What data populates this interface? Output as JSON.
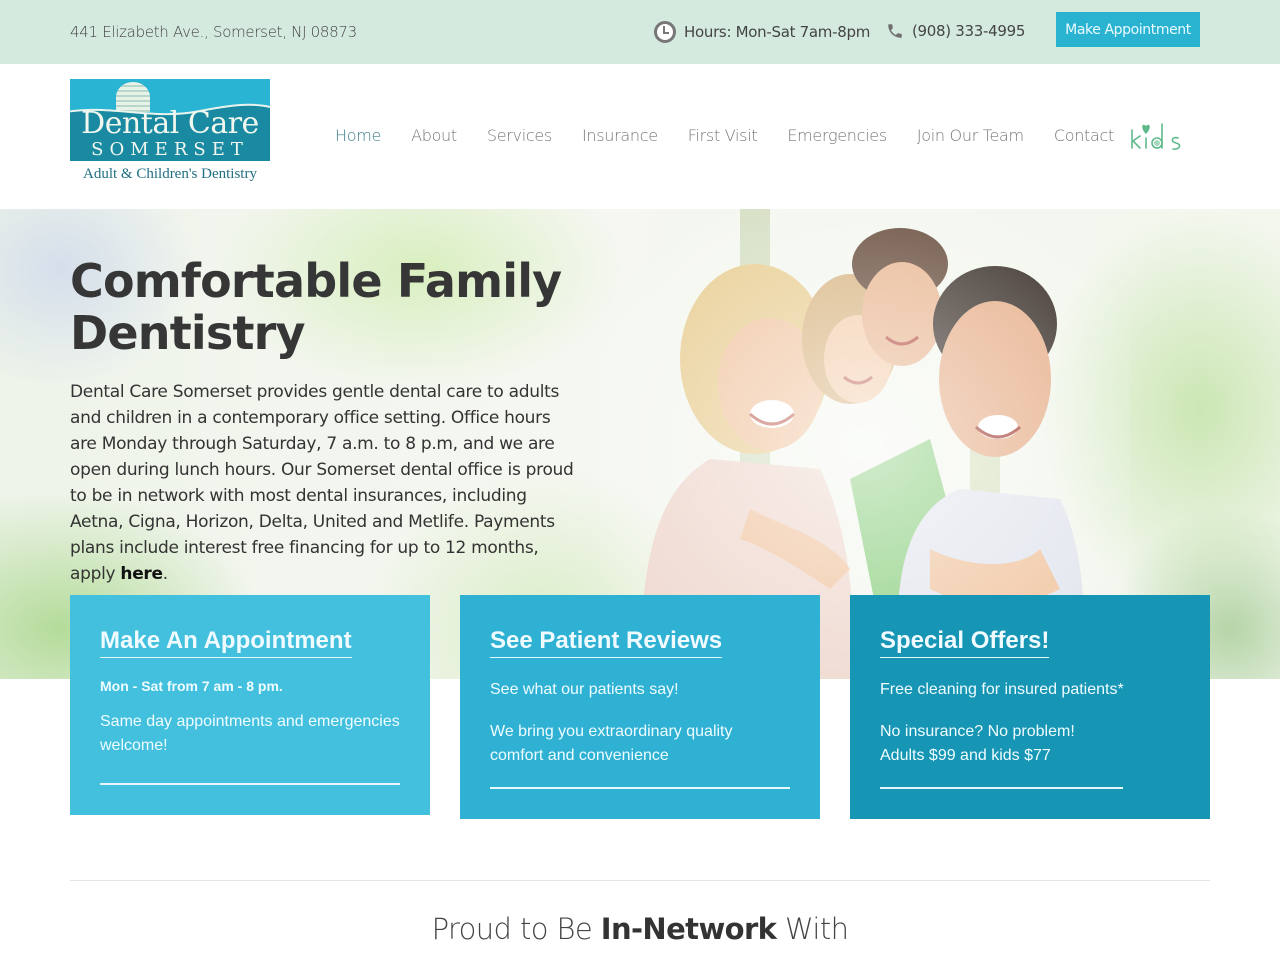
{
  "topbar": {
    "address": "441 Elizabeth Ave., Somerset, NJ 08873",
    "hours": "Hours: Mon-Sat 7am-8pm",
    "phone": "(908) 333-4995",
    "appointment_button": "Make Appointment",
    "hours_icon": "clock-icon",
    "phone_icon": "phone-icon"
  },
  "logo": {
    "name": "Dental Care",
    "city": "SOMERSET",
    "tagline": "Adult & Children's Dentistry"
  },
  "nav": {
    "items": [
      {
        "label": "Home",
        "active": true
      },
      {
        "label": "About"
      },
      {
        "label": "Services"
      },
      {
        "label": "Insurance"
      },
      {
        "label": "First Visit"
      },
      {
        "label": "Emergencies"
      },
      {
        "label": "Join Our Team"
      },
      {
        "label": "Contact"
      }
    ],
    "kids_label": "kids"
  },
  "hero": {
    "title_line1": "Comfortable Family",
    "title_line2": "Dentistry",
    "body": "Dental Care Somerset provides gentle dental care to adults and children in a contemporary office setting. Office hours are Monday through Saturday, 7 a.m. to 8 p.m, and we are open during lunch hours. Our Somerset dental office is proud to be in network with most dental insurances, including Aetna, Cigna, Horizon, Delta, United and Metlife. Payments plans include interest free financing for up to 12 months, apply ",
    "link_label": "here",
    "body_end": "."
  },
  "cards": [
    {
      "title": "Make An Appointment",
      "subtitle": "Mon - Sat from 7 am - 8 pm.",
      "lines": [
        "Same day appointments and emergencies welcome!"
      ],
      "color": "#44c0df"
    },
    {
      "title": "See Patient Reviews",
      "lines": [
        "See what our patients say!",
        "We bring you extraordinary quality comfort and convenience"
      ],
      "color": "#2fb1d4"
    },
    {
      "title": "Special Offers!",
      "lines": [
        "Free cleaning for insured patients*",
        "No insurance? No problem!",
        "Adults $99 and kids $77"
      ],
      "color": "#1795b4"
    }
  ],
  "network": {
    "prefix": "Proud to Be ",
    "bold": "In-Network",
    "suffix": " With"
  },
  "colors": {
    "topbar_bg": "#d5eadf",
    "accent": "#2ab3d1",
    "nav_active": "#3c7d88"
  }
}
